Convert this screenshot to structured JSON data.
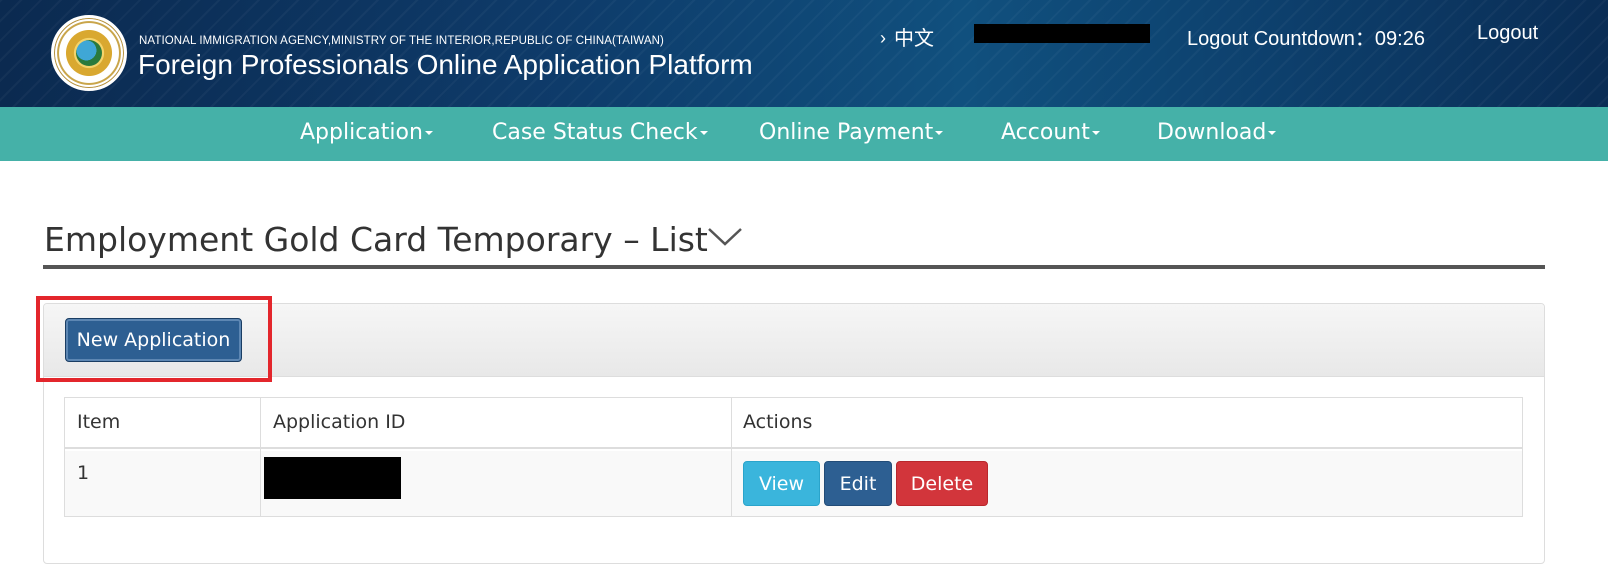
{
  "header": {
    "agency": "NATIONAL IMMIGRATION AGENCY,MINISTRY OF THE INTERIOR,REPUBLIC OF CHINA(TAIWAN)",
    "platform_title": "Foreign Professionals Online Application Platform",
    "language_link": "中文",
    "logout_countdown_label": "Logout Countdown：",
    "logout_countdown_value": "09:26",
    "logout_label": "Logout",
    "logo_icon": "national-immigration-agency-seal"
  },
  "nav": {
    "items": [
      {
        "label": "Application"
      },
      {
        "label": "Case Status Check"
      },
      {
        "label": "Online Payment"
      },
      {
        "label": "Account"
      },
      {
        "label": "Download"
      }
    ]
  },
  "page": {
    "title": "Employment Gold Card Temporary – List",
    "title_icon": "chevron-down-icon"
  },
  "toolbar": {
    "new_application_label": "New Application"
  },
  "table": {
    "columns": [
      "Item",
      "Application ID",
      "Actions"
    ],
    "rows": [
      {
        "item": "1",
        "application_id": "",
        "actions": [
          "View",
          "Edit",
          "Delete"
        ]
      }
    ]
  },
  "colors": {
    "header_bg": "#0e3b6a",
    "nav_bg": "#45b1a8",
    "primary_button": "#2d5f92",
    "info_button": "#3ab5dc",
    "danger_button": "#d2353b",
    "highlight": "#e3262c"
  }
}
